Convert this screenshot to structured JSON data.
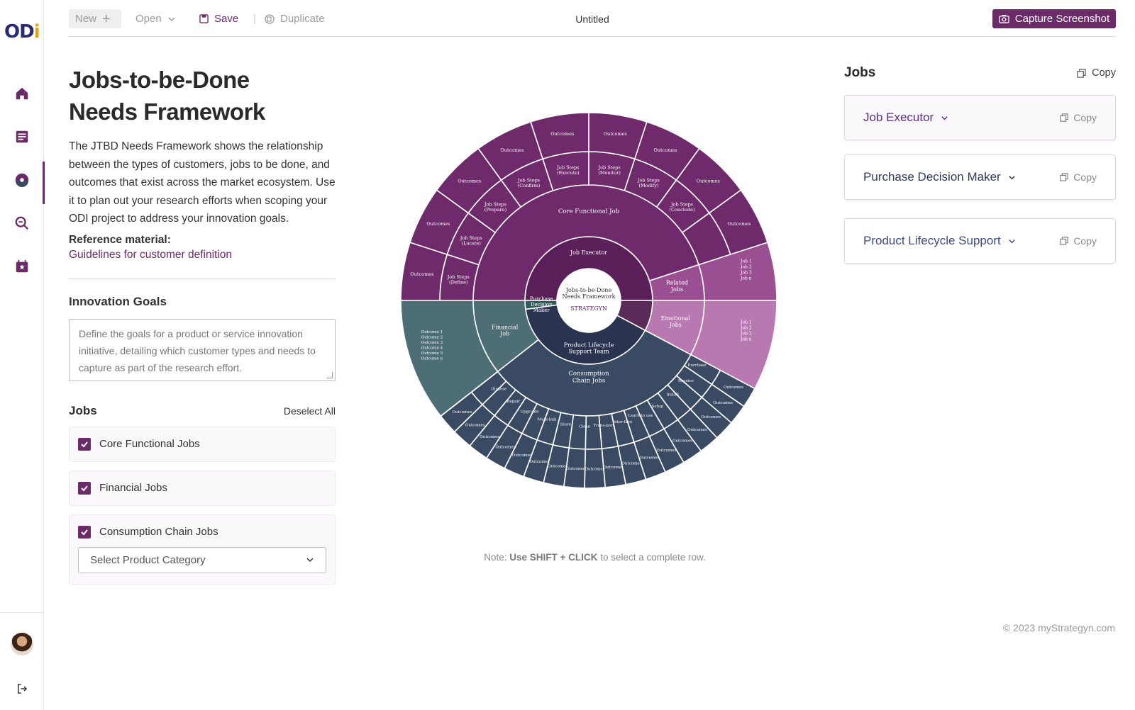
{
  "app": {
    "logo_main": "OD",
    "logo_accent": "i"
  },
  "toolbar": {
    "new_label": "New",
    "open_label": "Open",
    "save_label": "Save",
    "duplicate_label": "Duplicate",
    "document_title": "Untitled",
    "capture_label": "Capture Screenshot",
    "separator": "|"
  },
  "sidebar": {
    "items": [
      {
        "icon": "home-icon"
      },
      {
        "icon": "document-icon"
      },
      {
        "icon": "framework-icon",
        "active": true
      },
      {
        "icon": "search-icon"
      },
      {
        "icon": "calendar-star-icon"
      }
    ],
    "bottom": {
      "logout_icon": "logout-icon"
    }
  },
  "left": {
    "title_line1": "Jobs-to-be-Done",
    "title_line2": "Needs Framework",
    "description": "The JTBD Needs Framework shows the relationship between the types of customers, jobs to be done, and outcomes that exist across the market ecosystem. Use it to plan out your research efforts when scoping your ODI project to address your innovation goals.",
    "reference_label": "Reference material:",
    "reference_link": "Guidelines for customer definition",
    "goals_title": "Innovation Goals",
    "goals_placeholder": "Define the goals for a product or service innovation initiative, detailing which customer types and needs to capture as part of the research effort.",
    "jobs_title": "Jobs",
    "deselect_label": "Deselect All",
    "jobs": [
      {
        "label": "Core Functional Jobs",
        "checked": true
      },
      {
        "label": "Financial Jobs",
        "checked": true
      },
      {
        "label": "Consumption Chain Jobs",
        "checked": true
      }
    ],
    "category_select": "Select Product Category"
  },
  "wheel": {
    "center_line1": "Jobs-to-be-Done",
    "center_line2": "Needs Framework",
    "brand": "STRATEGYN",
    "ring1": {
      "job_executor": "Job Executor",
      "pdm_1": "Purchase",
      "pdm_2": "Decision",
      "pdm_3": "Maker",
      "plst_1": "Product Lifecycle",
      "plst_2": "Support Team"
    },
    "ring2": {
      "core": "Core Functional Job",
      "fin_1": "Financial",
      "fin_2": "Job",
      "consumption_1": "Consumption",
      "consumption_2": "Chain Jobs",
      "related_1": "Related",
      "related_2": "Jobs",
      "emotional_1": "Emotional",
      "emotional_2": "Jobs"
    },
    "steps": [
      "Job Steps",
      "(Define)",
      "(Locate)",
      "(Prepare)",
      "(Confirm)",
      "(Execute)",
      "(Monitor)",
      "(Modify)",
      "(Conclude)"
    ],
    "outcomes": "Outcomes",
    "chain": [
      "Purchase",
      "Receive",
      "Install",
      "Setup",
      "Learn",
      "to use",
      "Inter-",
      "face",
      "Trans-",
      "port",
      "Clean",
      "Store",
      "Main-",
      "tain",
      "Upgr-",
      "ade",
      "Repair",
      "Dispose"
    ],
    "job_list": [
      "Job 1",
      "Job 2",
      "Job 3",
      "Job n"
    ],
    "outcome_list": [
      "Outcome 1",
      "Outcome 2",
      "Outcome 3",
      "Outcome 4",
      "Outcome 5",
      "Outcome n"
    ]
  },
  "note": {
    "prefix": "Note:",
    "bold": "Use SHIFT + CLICK",
    "suffix": "to select a complete row."
  },
  "right": {
    "title": "Jobs",
    "copy_label": "Copy",
    "cards": [
      {
        "label": "Job Executor",
        "copy": "Copy"
      },
      {
        "label": "Purchase Decision Maker",
        "copy": "Copy"
      },
      {
        "label": "Product Lifecycle Support",
        "copy": "Copy"
      }
    ]
  },
  "footer": {
    "copyright": "© 2023 myStrategyn.com"
  },
  "colors": {
    "accent": "#6b2a68",
    "core": "#6e2a6b",
    "core_light": "#9a4f92",
    "emotional": "#b879b1",
    "financial": "#4c6e74",
    "consumption": "#3a4a63",
    "center_dark": "#5b1f5a"
  }
}
